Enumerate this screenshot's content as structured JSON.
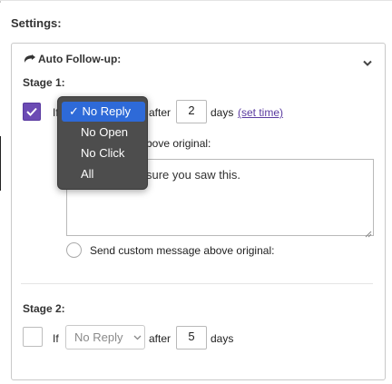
{
  "settings_title": "Settings:",
  "card": {
    "title": "Auto Follow-up:",
    "icon": "reply-arrow-icon",
    "collapse_icon": "chevron-down-icon"
  },
  "stage1": {
    "label": "Stage 1:",
    "checked": true,
    "if_label": "If",
    "after_label": "after",
    "days_value": "2",
    "days_label": "days",
    "set_time_link": "(set time)",
    "option_above_original_partial": "bove original:",
    "message_text_partial": "sure you saw this.",
    "custom_message_label": "Send custom message above original:"
  },
  "dropdown": {
    "selected_prefix": "✓",
    "options": [
      "No Reply",
      "No Open",
      "No Click",
      "All"
    ],
    "selected": "No Reply"
  },
  "stage2": {
    "label": "Stage 2:",
    "checked": false,
    "if_label": "If",
    "select_value": "No Reply",
    "after_label": "after",
    "days_value": "5",
    "days_label": "days"
  },
  "colors": {
    "accent": "#6c4bb4",
    "link": "#5a3aa0",
    "menu_bg": "#4d4d4d",
    "menu_highlight": "#2e6ad8"
  }
}
